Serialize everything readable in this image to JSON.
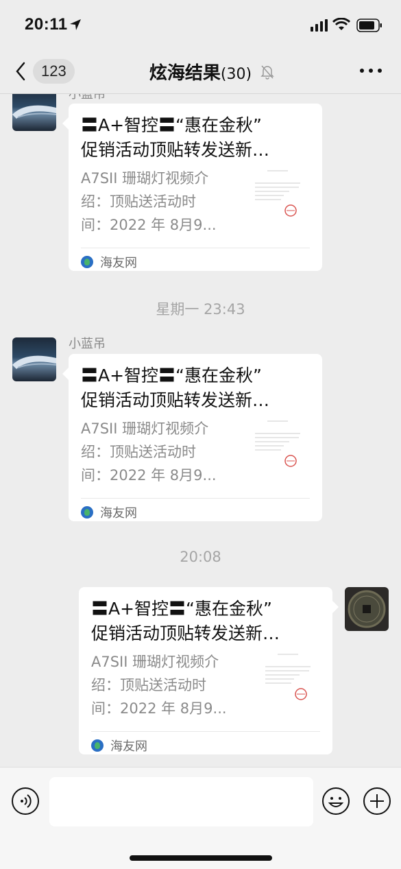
{
  "status_bar": {
    "time": "20:11"
  },
  "nav": {
    "back_count": "123",
    "title": "炫海结果",
    "member_count": "(30)"
  },
  "messages": [
    {
      "sender": "小蓝吊",
      "card": {
        "title_line1": "〓A+智控〓“惠在金秋”",
        "title_line2": "促销活动顶贴转发送新…",
        "desc_line1": "A7SII 珊瑚灯视频介",
        "desc_line2": "绍：顶贴送活动时",
        "desc_line3": "间：2022 年 8月9...",
        "source": "海友网"
      }
    },
    {
      "timestamp": "星期一 23:43",
      "sender": "小蓝吊",
      "card": {
        "title_line1": "〓A+智控〓“惠在金秋”",
        "title_line2": "促销活动顶贴转发送新…",
        "desc_line1": "A7SII 珊瑚灯视频介",
        "desc_line2": "绍：顶贴送活动时",
        "desc_line3": "间：2022 年 8月9...",
        "source": "海友网"
      }
    },
    {
      "timestamp": "20:08",
      "card": {
        "title_line1": "〓A+智控〓“惠在金秋”",
        "title_line2": "促销活动顶贴转发送新…",
        "desc_line1": "A7SII 珊瑚灯视频介",
        "desc_line2": "绍：顶贴送活动时",
        "desc_line3": "间：2022 年 8月9...",
        "source": "海友网"
      }
    }
  ],
  "icons": {
    "status": [
      "location-arrow-icon",
      "signal-icon",
      "wifi-icon",
      "battery-icon"
    ],
    "nav": [
      "back-chevron-icon",
      "mute-bell-icon",
      "more-dots-icon"
    ],
    "input": [
      "voice-icon",
      "emoji-icon",
      "plus-icon"
    ]
  },
  "colors": {
    "background": "#ededed",
    "bubble": "#ffffff",
    "timestamp": "#a5a5a5"
  }
}
